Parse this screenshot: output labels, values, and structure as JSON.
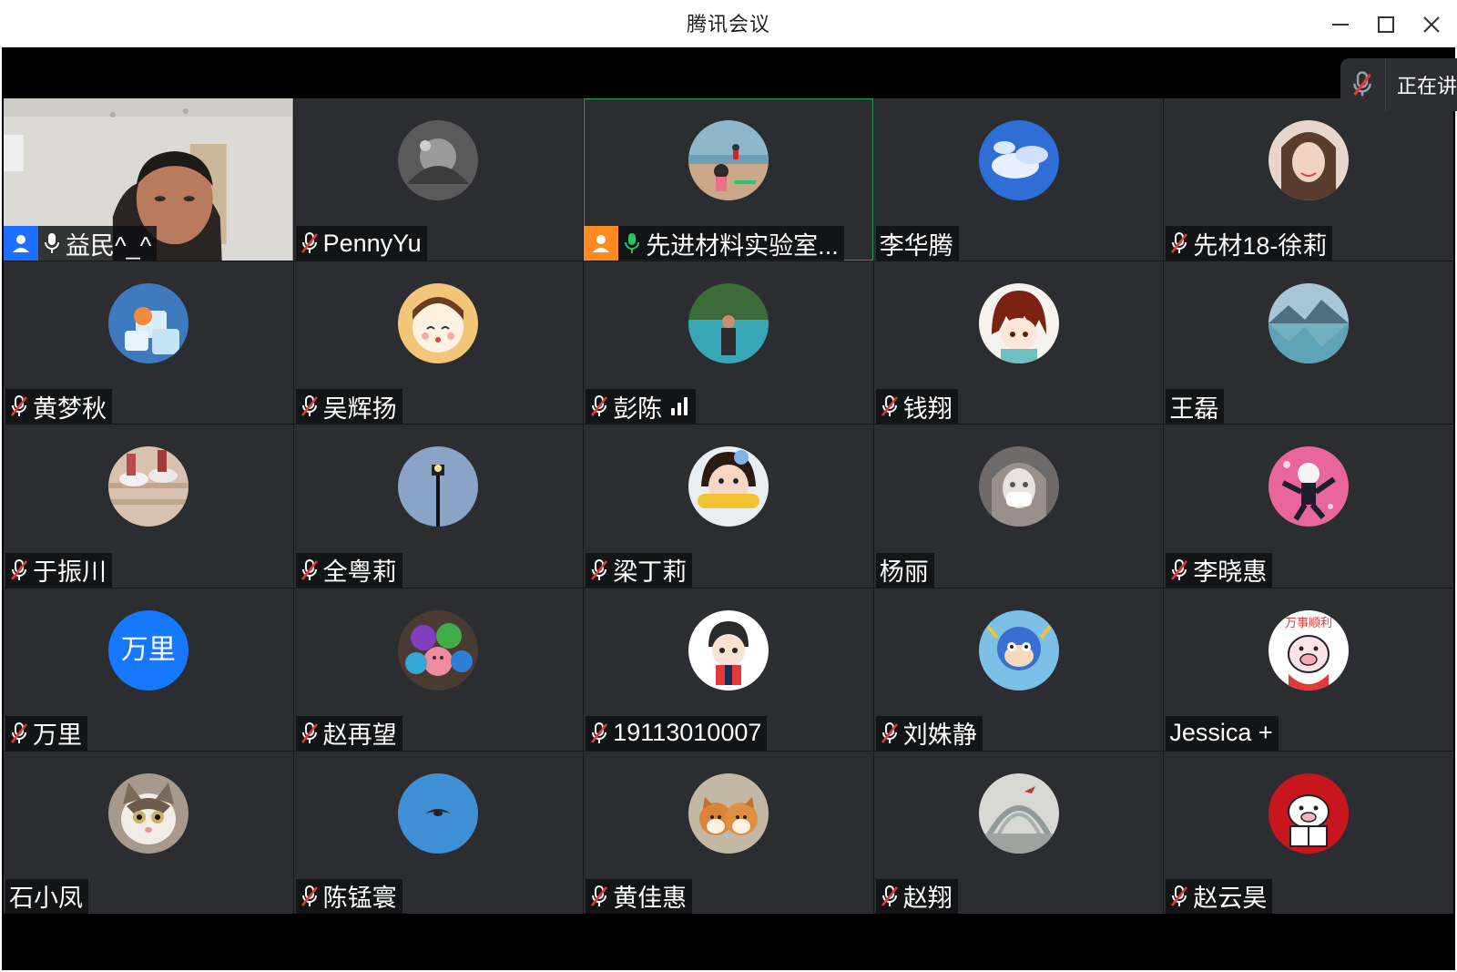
{
  "window": {
    "title": "腾讯会议"
  },
  "speaking_indicator": {
    "label": "正在讲"
  },
  "participants": [
    {
      "name": "益民^_^",
      "mic": "on",
      "role": "host",
      "video": true
    },
    {
      "name": "PennyYu",
      "mic": "muted",
      "avatar": "bw-photo"
    },
    {
      "name": "先进材料实验室...",
      "mic": "on",
      "role": "cohost",
      "active": true,
      "avatar": "beach-photo"
    },
    {
      "name": "李华腾",
      "mic": "none",
      "avatar": "sky-photo"
    },
    {
      "name": "先材18-徐莉",
      "mic": "muted",
      "avatar": "portrait-photo"
    },
    {
      "name": "黄梦秋",
      "mic": "muted",
      "avatar": "ice-photo"
    },
    {
      "name": "吴辉扬",
      "mic": "muted",
      "avatar": "cartoon-girl"
    },
    {
      "name": "彭陈",
      "mic": "muted",
      "signal": true,
      "avatar": "lake-person-photo"
    },
    {
      "name": "钱翔",
      "mic": "muted",
      "avatar": "anime-boy"
    },
    {
      "name": "王磊",
      "mic": "none",
      "avatar": "mountain-lake-photo"
    },
    {
      "name": "于振川",
      "mic": "muted",
      "avatar": "shoes-photo"
    },
    {
      "name": "全粤莉",
      "mic": "muted",
      "avatar": "streetlamp-photo"
    },
    {
      "name": "梁丁莉",
      "mic": "muted",
      "avatar": "child-corn-photo"
    },
    {
      "name": "杨丽",
      "mic": "none",
      "avatar": "anime-mask-girl"
    },
    {
      "name": "李晓惠",
      "mic": "muted",
      "avatar": "anime-pink"
    },
    {
      "name": "万里",
      "mic": "muted",
      "avatar_text": "万里",
      "avatar_color": "#1677ff"
    },
    {
      "name": "赵再望",
      "mic": "muted",
      "avatar": "toy-balls"
    },
    {
      "name": "19113010007",
      "mic": "muted",
      "avatar": "cartoon-boy"
    },
    {
      "name": "刘姝静",
      "mic": "muted",
      "avatar": "cartoon-robot"
    },
    {
      "name": "Jessica +",
      "mic": "none",
      "avatar": "pig-cartoon"
    },
    {
      "name": "石小凤",
      "mic": "none",
      "avatar": "cat-photo"
    },
    {
      "name": "陈锰寰",
      "mic": "muted",
      "avatar": "bird-sky-photo"
    },
    {
      "name": "黄佳惠",
      "mic": "muted",
      "avatar": "shiba-dogs-photo"
    },
    {
      "name": "赵翔",
      "mic": "muted",
      "avatar": "arcade-photo"
    },
    {
      "name": "赵云昊",
      "mic": "muted",
      "avatar": "pig-red-circle"
    }
  ],
  "colors": {
    "tile_bg": "#2b2d31",
    "active_border": "#1aa35f",
    "host_badge": "#1e6fff",
    "cohost_badge": "#ff8a1f",
    "mic_on": "#22c55e",
    "mic_muted": "#e53935"
  }
}
